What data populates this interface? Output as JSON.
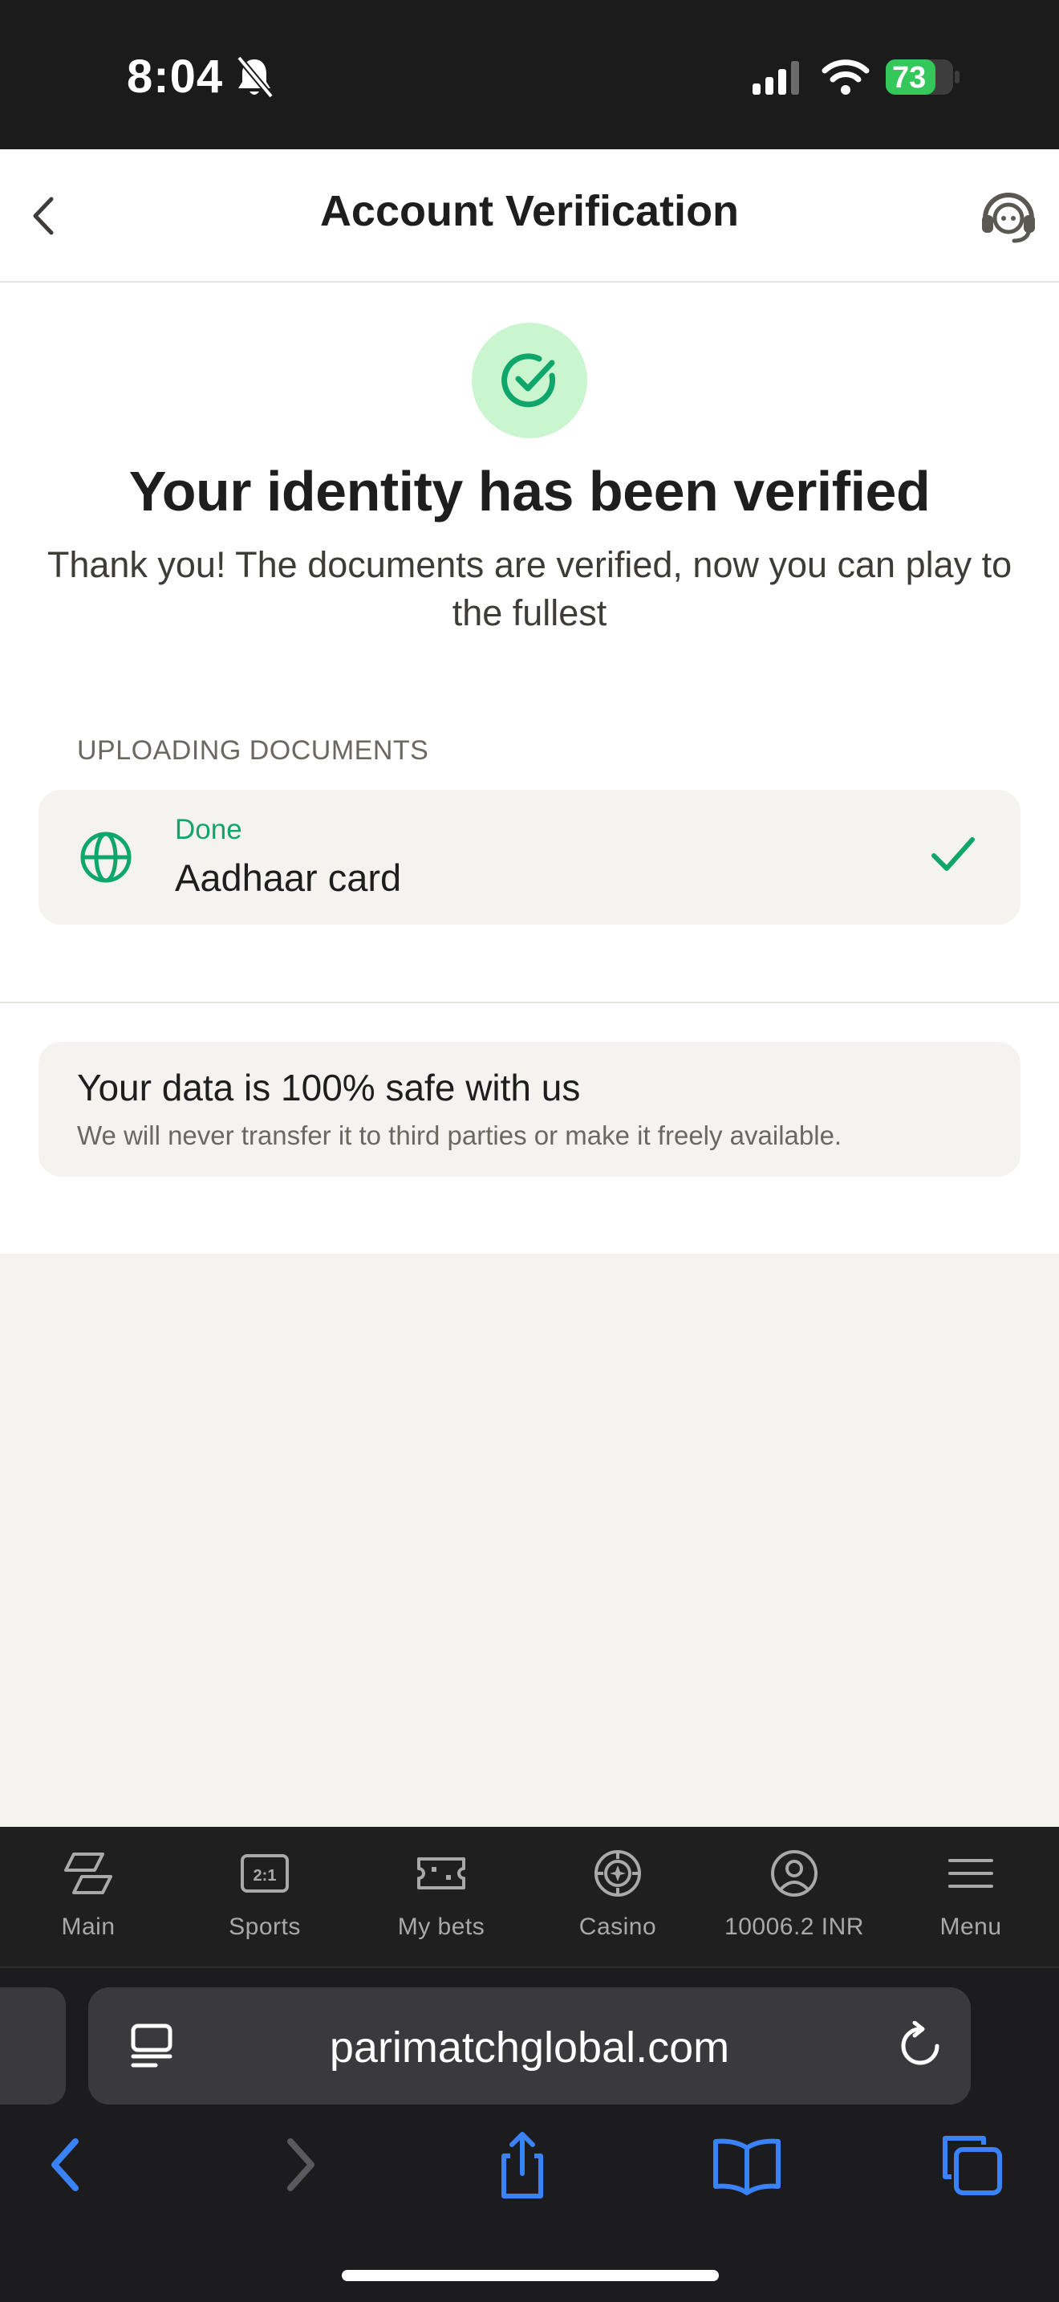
{
  "status_bar": {
    "time": "8:04",
    "battery": "73",
    "icons": [
      "bell-slash-icon",
      "signal-icon",
      "wifi-icon",
      "battery-charging-icon"
    ]
  },
  "header": {
    "title": "Account Verification",
    "back_icon": "chevron-left-icon",
    "support_icon": "headset-icon"
  },
  "verification": {
    "badge_icon": "check-circle-icon",
    "heading": "Your identity has been verified",
    "subtext": "Thank you! The documents are verified, now you can play to the fullest"
  },
  "documents": {
    "section_label": "UPLOADING DOCUMENTS",
    "items": [
      {
        "icon": "globe-icon",
        "status": "Done",
        "name": "Aadhaar card",
        "status_icon": "checkmark-icon"
      }
    ]
  },
  "safety": {
    "title": "Your data is 100% safe with us",
    "text": "We will never transfer it to third parties or make it freely available."
  },
  "tabbar": {
    "tabs": [
      {
        "label": "Main",
        "icon": "main-icon"
      },
      {
        "label": "Sports",
        "icon": "sports-icon"
      },
      {
        "label": "My bets",
        "icon": "ticket-icon"
      },
      {
        "label": "Casino",
        "icon": "casino-chip-icon"
      },
      {
        "label": "10006.2 INR",
        "icon": "user-circle-icon"
      },
      {
        "label": "Menu",
        "icon": "hamburger-icon"
      }
    ]
  },
  "browser": {
    "url": "parimatchglobal.com",
    "toolbar_icons": [
      "back-icon",
      "forward-icon",
      "share-icon",
      "bookmarks-icon",
      "tabs-icon"
    ]
  },
  "colors": {
    "accent_green": "#0ea66a",
    "badge_bg": "#c9f5cf",
    "browser_blue": "#3a82f7"
  }
}
